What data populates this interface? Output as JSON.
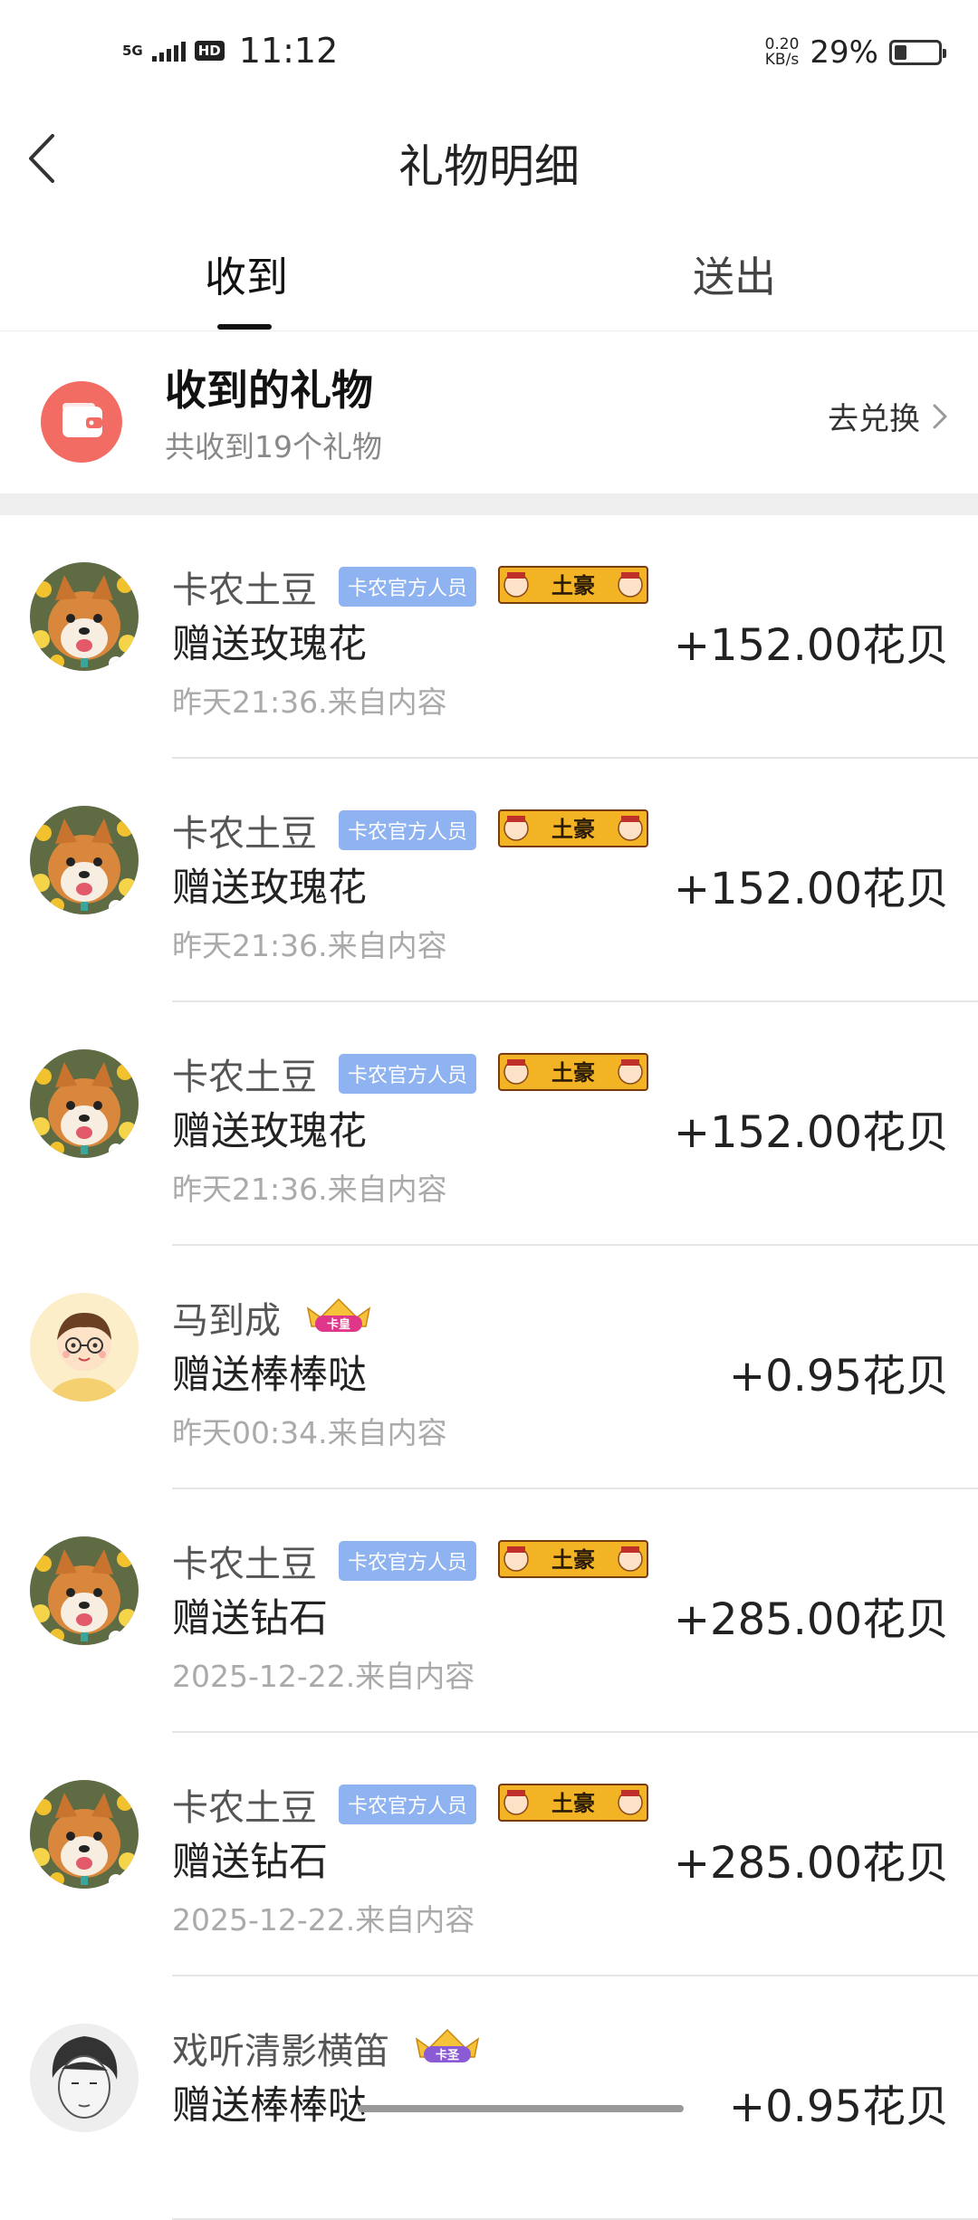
{
  "status_bar": {
    "network": "5G",
    "hd": "HD",
    "time": "11:12",
    "speed_value": "0.20",
    "speed_unit": "KB/s",
    "battery_percent": "29%",
    "battery_level": 0.29
  },
  "header": {
    "title": "礼物明细",
    "back_icon": "chevron-left-icon"
  },
  "tabs": [
    {
      "label": "收到",
      "active": true
    },
    {
      "label": "送出",
      "active": false
    }
  ],
  "summary": {
    "title": "收到的礼物",
    "subtitle": "共收到19个礼物",
    "redeem_label": "去兑换",
    "icon": "wallet-icon",
    "icon_color": "#f36c64"
  },
  "gifts": [
    {
      "name": "卡农土豆",
      "badge_official": "卡农官方人员",
      "badge_level": "土豪",
      "action": "赠送玫瑰花",
      "time": "昨天21:36.来自内容",
      "amount": "+152.00花贝",
      "avatar": "shiba-avatar"
    },
    {
      "name": "卡农土豆",
      "badge_official": "卡农官方人员",
      "badge_level": "土豪",
      "action": "赠送玫瑰花",
      "time": "昨天21:36.来自内容",
      "amount": "+152.00花贝",
      "avatar": "shiba-avatar"
    },
    {
      "name": "卡农土豆",
      "badge_official": "卡农官方人员",
      "badge_level": "土豪",
      "action": "赠送玫瑰花",
      "time": "昨天21:36.来自内容",
      "amount": "+152.00花贝",
      "avatar": "shiba-avatar"
    },
    {
      "name": "马到成",
      "badge_crown": "卡皇",
      "action": "赠送棒棒哒",
      "time": "昨天00:34.来自内容",
      "amount": "+0.95花贝",
      "avatar": "cartoon-boy-avatar"
    },
    {
      "name": "卡农土豆",
      "badge_official": "卡农官方人员",
      "badge_level": "土豪",
      "action": "赠送钻石",
      "time": "2025-12-22.来自内容",
      "amount": "+285.00花贝",
      "avatar": "shiba-avatar"
    },
    {
      "name": "卡农土豆",
      "badge_official": "卡农官方人员",
      "badge_level": "土豪",
      "action": "赠送钻石",
      "time": "2025-12-22.来自内容",
      "amount": "+285.00花贝",
      "avatar": "shiba-avatar"
    },
    {
      "name": "戏听清影横笛",
      "badge_crown": "卡圣",
      "action": "赠送棒棒哒",
      "time": "",
      "amount": "+0.95花贝",
      "avatar": "sketch-portrait-avatar"
    }
  ]
}
